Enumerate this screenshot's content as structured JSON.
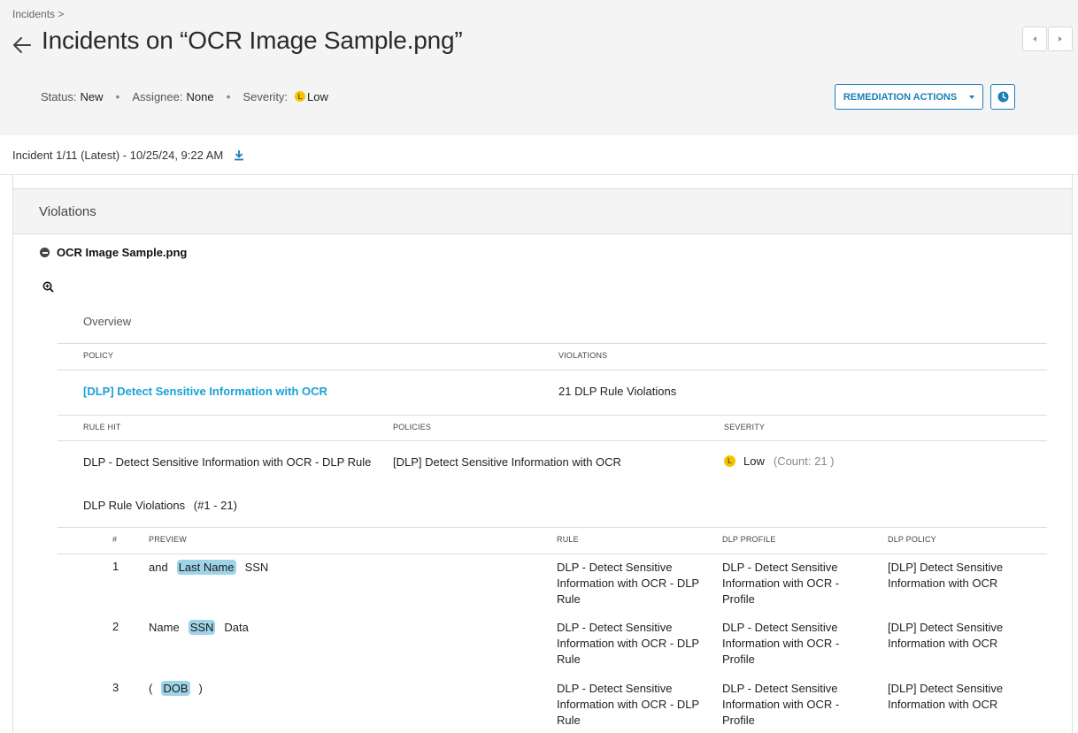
{
  "breadcrumb": "Incidents >",
  "title": "Incidents on “OCR Image Sample.png”",
  "status": {
    "status_label": "Status:",
    "status_value": "New",
    "assignee_label": "Assignee:",
    "assignee_value": "None",
    "severity_label": "Severity:",
    "severity_value": "Low",
    "severity_icon": "L",
    "severity_color": "#f5c400"
  },
  "remediation_label": "REMEDIATION ACTIONS",
  "accent_color": "#1b7fb5",
  "incident_label": "Incident 1/11 (Latest) - 10/25/24, 9:22 AM",
  "violations_heading": "Violations",
  "file_name": "OCR Image Sample.png",
  "overview": {
    "title": "Overview",
    "policy_header": "POLICY",
    "violations_header": "VIOLATIONS",
    "policy_name": "[DLP] Detect Sensitive Information with OCR",
    "violations_count": "21 DLP Rule Violations"
  },
  "rules": {
    "rule_hit_header": "RULE HIT",
    "policies_header": "POLICIES",
    "severity_header": "SEVERITY",
    "rule_hit": "DLP - Detect Sensitive Information with OCR - DLP Rule",
    "policies": "[DLP] Detect Sensitive Information with OCR",
    "severity": "Low",
    "count": "(Count: 21 )"
  },
  "dlp_violations_label": "DLP Rule Violations",
  "dlp_violations_range": "(#1 - 21)",
  "table": {
    "headers": [
      "#",
      "PREVIEW",
      "RULE",
      "DLP PROFILE",
      "DLP POLICY"
    ],
    "rows": [
      {
        "num": "1",
        "pre": "and",
        "hit": "Last Name",
        "post": "SSN",
        "rule": "DLP - Detect Sensitive Information with OCR - DLP Rule",
        "profile": "DLP - Detect Sensitive Information with OCR - Profile",
        "policy": "[DLP] Detect Sensitive Information with OCR"
      },
      {
        "num": "2",
        "pre": "Name",
        "hit": "SSN",
        "post": "Data",
        "rule": "DLP - Detect Sensitive Information with OCR - DLP Rule",
        "profile": "DLP - Detect Sensitive Information with OCR - Profile",
        "policy": "[DLP] Detect Sensitive Information with OCR"
      },
      {
        "num": "3",
        "pre": "(",
        "hit": "DOB",
        "post": ")",
        "rule": "DLP - Detect Sensitive Information with OCR - DLP Rule",
        "profile": "DLP - Detect Sensitive Information with OCR - Profile",
        "policy": "[DLP] Detect Sensitive Information with OCR"
      }
    ]
  }
}
